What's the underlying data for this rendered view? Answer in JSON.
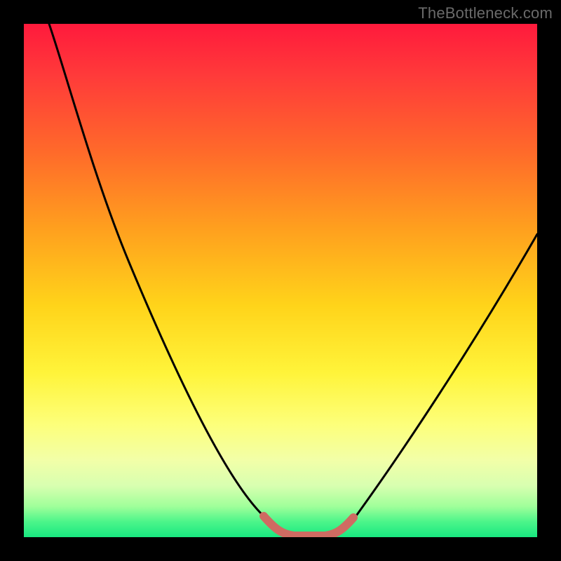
{
  "watermark": "TheBottleneck.com",
  "chart_data": {
    "type": "line",
    "title": "",
    "xlabel": "",
    "ylabel": "",
    "xlim": [
      0,
      100
    ],
    "ylim": [
      0,
      100
    ],
    "series": [
      {
        "name": "bottleneck-curve",
        "x": [
          5,
          10,
          15,
          20,
          25,
          30,
          35,
          40,
          45,
          48,
          50,
          52,
          54,
          56,
          58,
          60,
          65,
          70,
          75,
          80,
          85,
          90,
          95,
          100
        ],
        "values": [
          100,
          89,
          78,
          67,
          56,
          45,
          34,
          23,
          12,
          6,
          3,
          1,
          0,
          0,
          0,
          1,
          5,
          12,
          20,
          28,
          36,
          44,
          52,
          60
        ]
      },
      {
        "name": "valley-highlight",
        "x": [
          48,
          50,
          52,
          54,
          56,
          58,
          60,
          62
        ],
        "values": [
          4,
          2,
          1,
          0,
          0,
          1,
          2,
          5
        ]
      }
    ],
    "colors": {
      "curve": "#000000",
      "highlight": "#cf6b62",
      "gradient_top": "#ff1a3c",
      "gradient_bottom": "#18e880"
    }
  }
}
